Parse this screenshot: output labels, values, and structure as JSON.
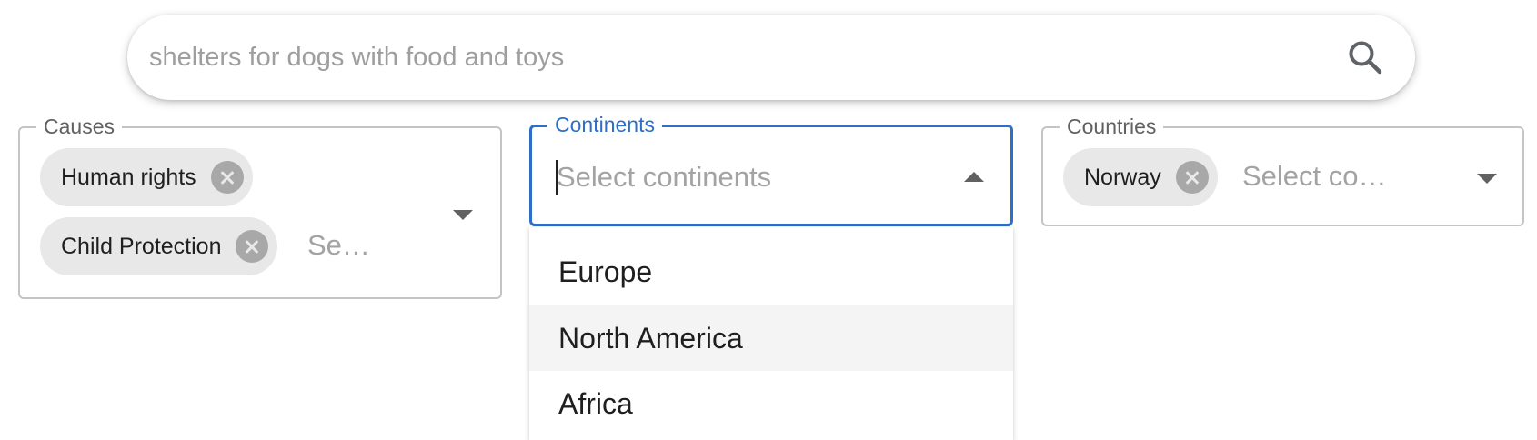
{
  "search": {
    "placeholder": "shelters for dogs with food and toys",
    "icon": "search-icon"
  },
  "causes": {
    "label": "Causes",
    "chips": [
      "Human rights",
      "Child Protection"
    ],
    "placeholder": "Se…",
    "icon": "chevron-down-icon"
  },
  "continents": {
    "label": "Continents",
    "placeholder": "Select continents",
    "icon": "chevron-up-icon",
    "options": [
      "Europe",
      "North America",
      "Africa"
    ],
    "highlighted": "North America"
  },
  "countries": {
    "label": "Countries",
    "chips": [
      "Norway"
    ],
    "placeholder": "Select co…",
    "icon": "chevron-down-icon"
  },
  "colors": {
    "focus": "#2f6fc7",
    "chip_bg": "#e8e8e8",
    "option_hover": "#f4f4f4"
  }
}
